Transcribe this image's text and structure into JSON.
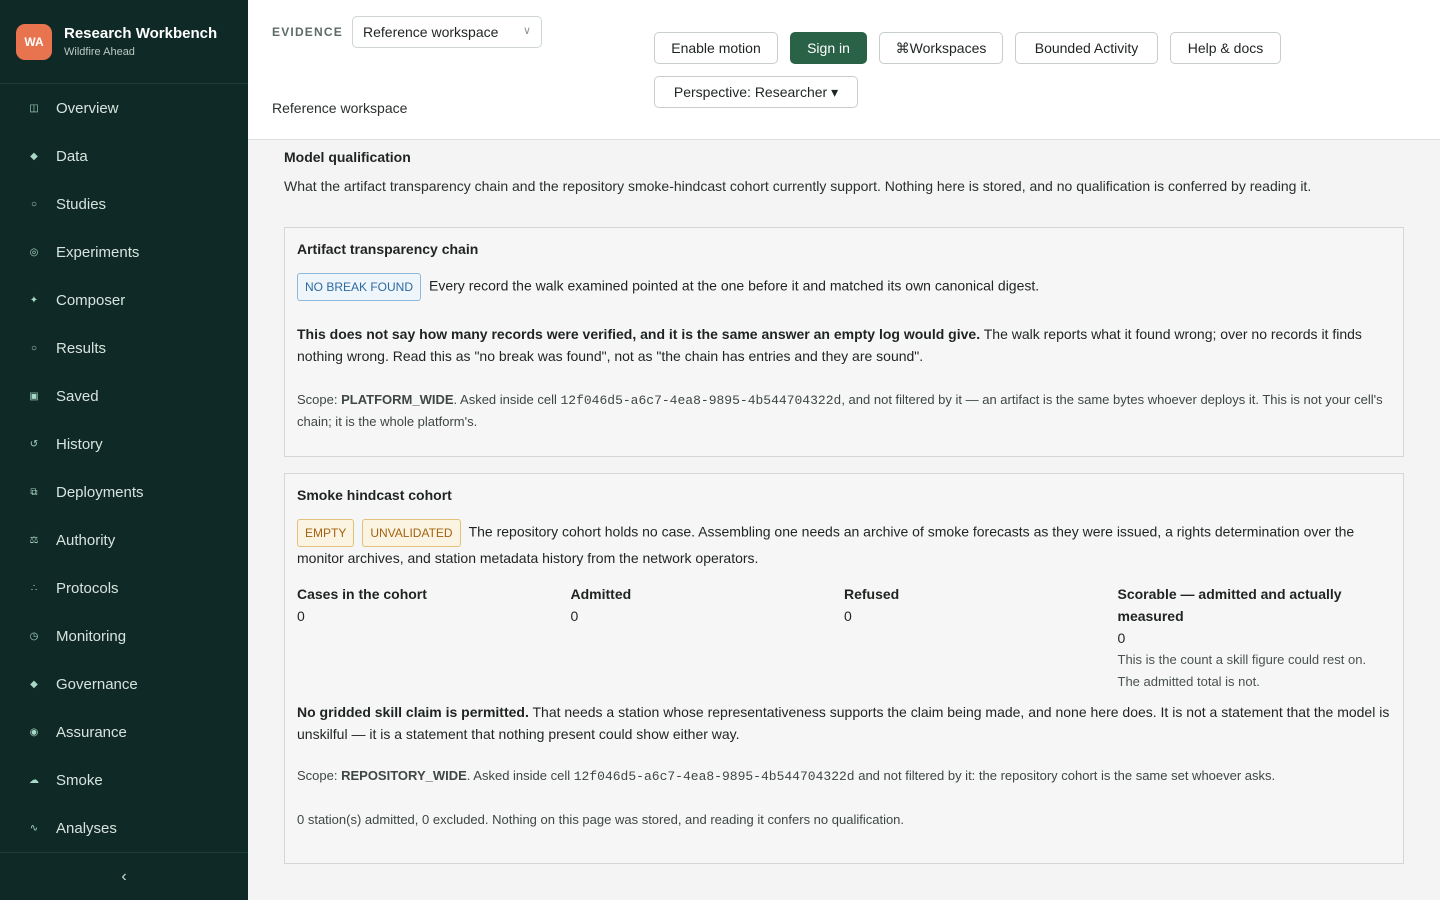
{
  "brand": {
    "badge": "WA",
    "title": "Research Workbench",
    "subtitle": "Wildfire Ahead"
  },
  "sidebar": {
    "items": [
      {
        "label": "Overview",
        "icon": "overview-icon",
        "glyph": "◫"
      },
      {
        "label": "Data",
        "icon": "data-icon",
        "glyph": "◆"
      },
      {
        "label": "Studies",
        "icon": "studies-icon",
        "glyph": "○"
      },
      {
        "label": "Experiments",
        "icon": "experiments-icon",
        "glyph": "◎"
      },
      {
        "label": "Composer",
        "icon": "composer-icon",
        "glyph": "✦"
      },
      {
        "label": "Results",
        "icon": "results-icon",
        "glyph": "○"
      },
      {
        "label": "Saved",
        "icon": "saved-icon",
        "glyph": "▣"
      },
      {
        "label": "History",
        "icon": "history-icon",
        "glyph": "↺"
      },
      {
        "label": "Deployments",
        "icon": "deployments-icon",
        "glyph": "⧉"
      },
      {
        "label": "Authority",
        "icon": "authority-icon",
        "glyph": "⚖"
      },
      {
        "label": "Protocols",
        "icon": "protocols-icon",
        "glyph": "∴"
      },
      {
        "label": "Monitoring",
        "icon": "monitoring-icon",
        "glyph": "◷"
      },
      {
        "label": "Governance",
        "icon": "governance-icon",
        "glyph": "◆"
      },
      {
        "label": "Assurance",
        "icon": "assurance-icon",
        "glyph": "◉"
      },
      {
        "label": "Smoke",
        "icon": "smoke-icon",
        "glyph": "☁"
      },
      {
        "label": "Analyses",
        "icon": "analyses-icon",
        "glyph": "∿"
      }
    ],
    "collapse_glyph": "‹"
  },
  "header": {
    "evidence_label": "EVIDENCE",
    "workspace_select": "Reference workspace",
    "workspace_caption": "Reference workspace",
    "buttons": {
      "enable_motion": "Enable motion",
      "sign_in": "Sign in",
      "workspaces": "⌘Workspaces",
      "bounded_activity": "Bounded Activity",
      "help": "Help & docs",
      "perspective": "Perspective: Researcher ▾"
    }
  },
  "main": {
    "title": "Model qualification",
    "description": "What the artifact transparency chain and the repository smoke-hindcast cohort currently support. Nothing here is stored, and no qualification is conferred by reading it.",
    "chain": {
      "title": "Artifact transparency chain",
      "badge": "NO BREAK FOUND",
      "summary": "Every record the walk examined pointed at the one before it and matched its own canonical digest.",
      "warning_bold": "This does not say how many records were verified, and it is the same answer an empty log would give.",
      "warning_rest": " The walk reports what it found wrong; over no records it finds nothing wrong. Read this as \"no break was found\", not as \"the chain has entries and they are sound\".",
      "scope_prefix": "Scope: ",
      "scope_value": "PLATFORM_WIDE",
      "scope_mid": ". Asked inside cell ",
      "cell_id": "12f046d5-a6c7-4ea8-9895-4b544704322d",
      "scope_rest": ", and not filtered by it — an artifact is the same bytes whoever deploys it. This is not your cell's chain; it is the whole platform's."
    },
    "cohort": {
      "title": "Smoke hindcast cohort",
      "badge_empty": "EMPTY",
      "badge_unvalidated": "UNVALIDATED",
      "summary": "The repository cohort holds no case. Assembling one needs an archive of smoke forecasts as they were issued, a rights determination over the monitor archives, and station metadata history from the network operators.",
      "metrics": [
        {
          "label": "Cases in the cohort",
          "value": "0"
        },
        {
          "label": "Admitted",
          "value": "0"
        },
        {
          "label": "Refused",
          "value": "0"
        },
        {
          "label": "Scorable — admitted and actually measured",
          "value": "0",
          "note": "This is the count a skill figure could rest on. The admitted total is not."
        }
      ],
      "claim_bold": "No gridded skill claim is permitted.",
      "claim_rest": " That needs a station whose representativeness supports the claim being made, and none here does. It is not a statement that the model is unskilful — it is a statement that nothing present could show either way.",
      "scope_prefix": "Scope: ",
      "scope_value": "REPOSITORY_WIDE",
      "scope_mid": ". Asked inside cell ",
      "cell_id": "12f046d5-a6c7-4ea8-9895-4b544704322d",
      "scope_rest": " and not filtered by it: the repository cohort is the same set whoever asks.",
      "footer": "0 station(s) admitted, 0 excluded. Nothing on this page was stored, and reading it confers no qualification."
    }
  },
  "colors": {
    "sidebar_bg": "#0f2a26",
    "accent": "#2a6248",
    "brand_badge": "#e8734f"
  }
}
